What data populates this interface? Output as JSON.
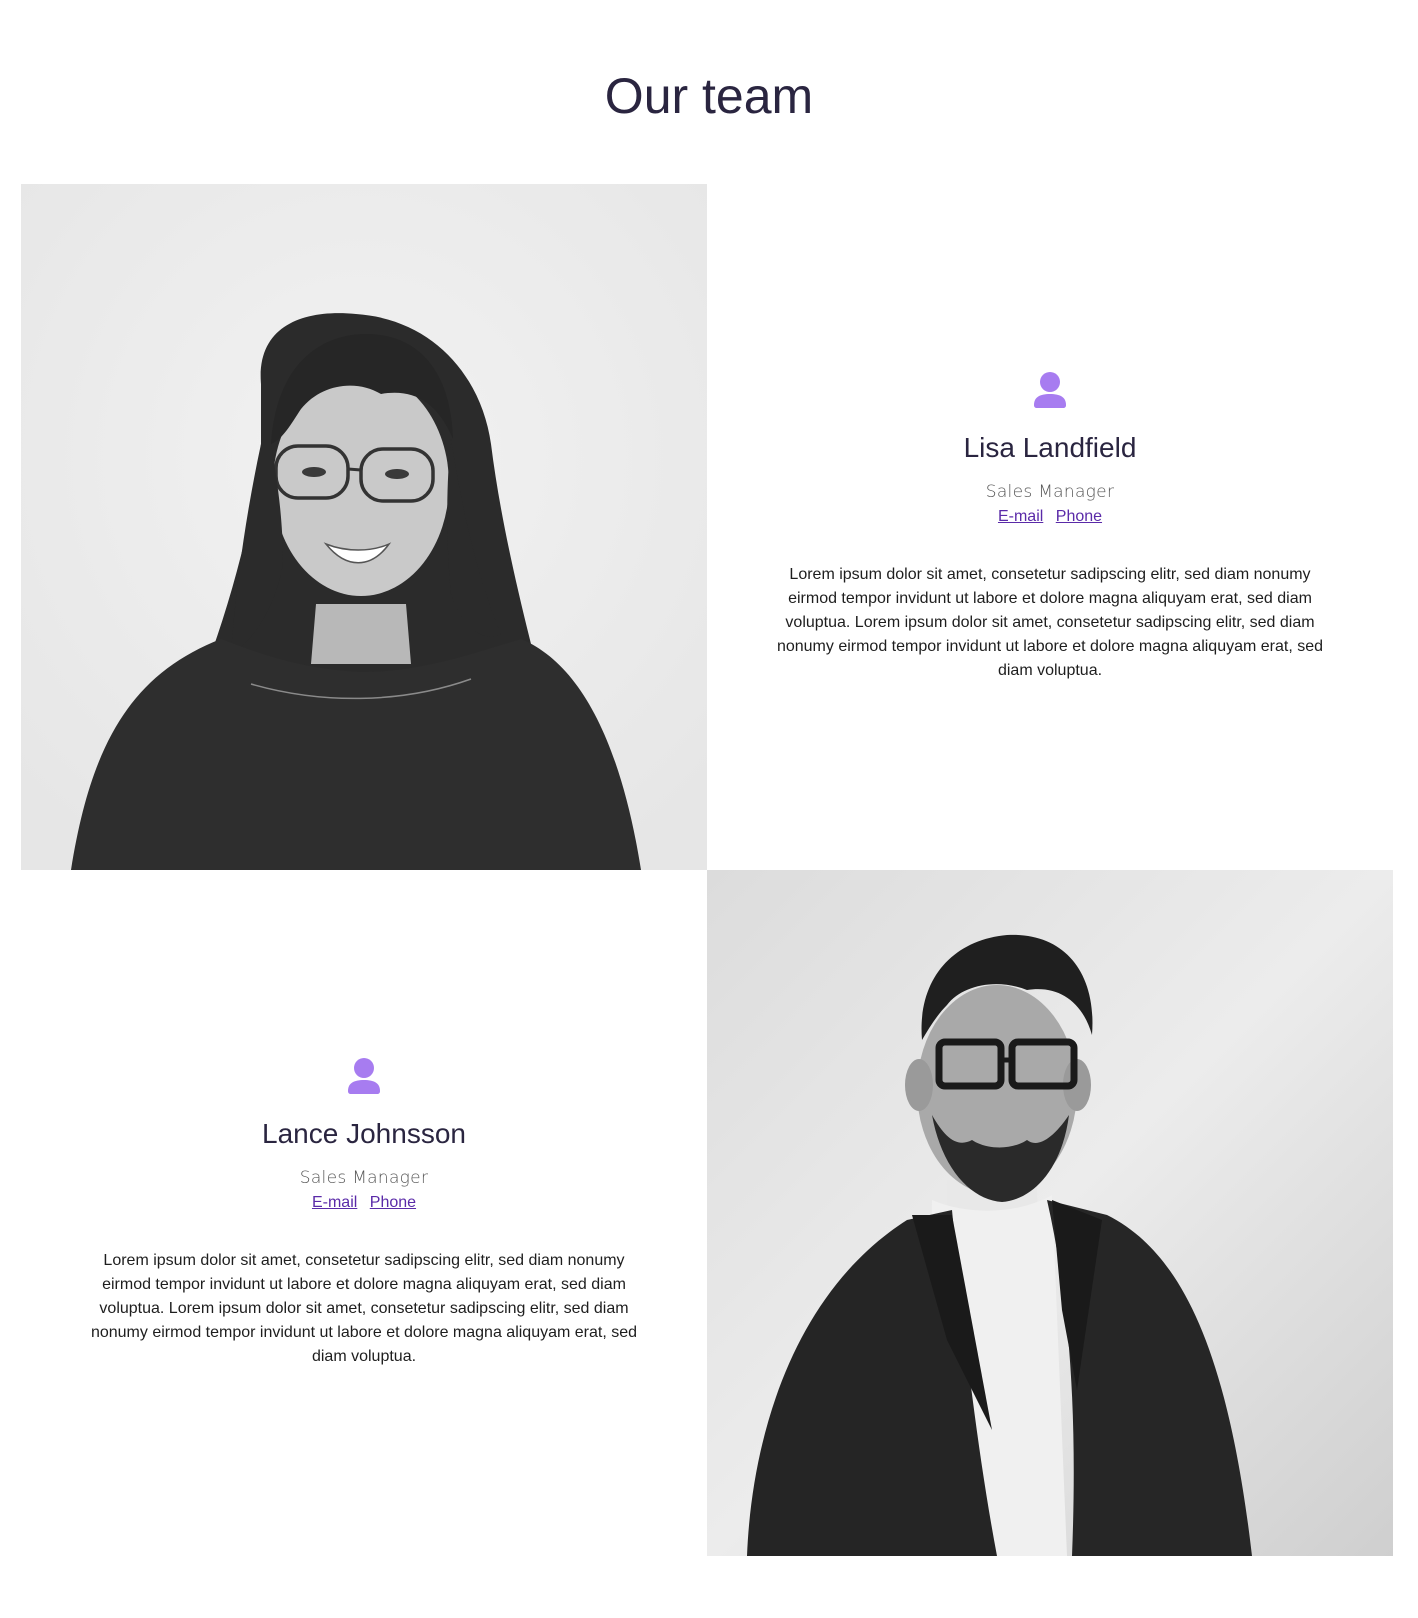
{
  "page": {
    "title": "Our team"
  },
  "colors": {
    "accent": "#a77cf0",
    "heading": "#2a2540",
    "link": "#5a2aa8"
  },
  "members": [
    {
      "icon": "person-icon",
      "name": "Lisa Landfield",
      "role": "Sales Manager",
      "email_label": "E-mail",
      "phone_label": "Phone",
      "bio": "Lorem ipsum dolor sit amet, consetetur sadipscing elitr, sed diam nonumy eirmod tempor invidunt ut labore et dolore magna aliquyam erat, sed diam voluptua. Lorem ipsum dolor sit amet, consetetur sadipscing elitr, sed diam nonumy eirmod tempor invidunt ut labore et dolore magna aliquyam erat, sed diam voluptua."
    },
    {
      "icon": "person-icon",
      "name": "Lance Johnsson",
      "role": "Sales Manager",
      "email_label": "E-mail",
      "phone_label": "Phone",
      "bio": "Lorem ipsum dolor sit amet, consetetur sadipscing elitr, sed diam nonumy eirmod tempor invidunt ut labore et dolore magna aliquyam erat, sed diam voluptua. Lorem ipsum dolor sit amet, consetetur sadipscing elitr, sed diam nonumy eirmod tempor invidunt ut labore et dolore magna aliquyam erat, sed diam voluptua."
    }
  ]
}
